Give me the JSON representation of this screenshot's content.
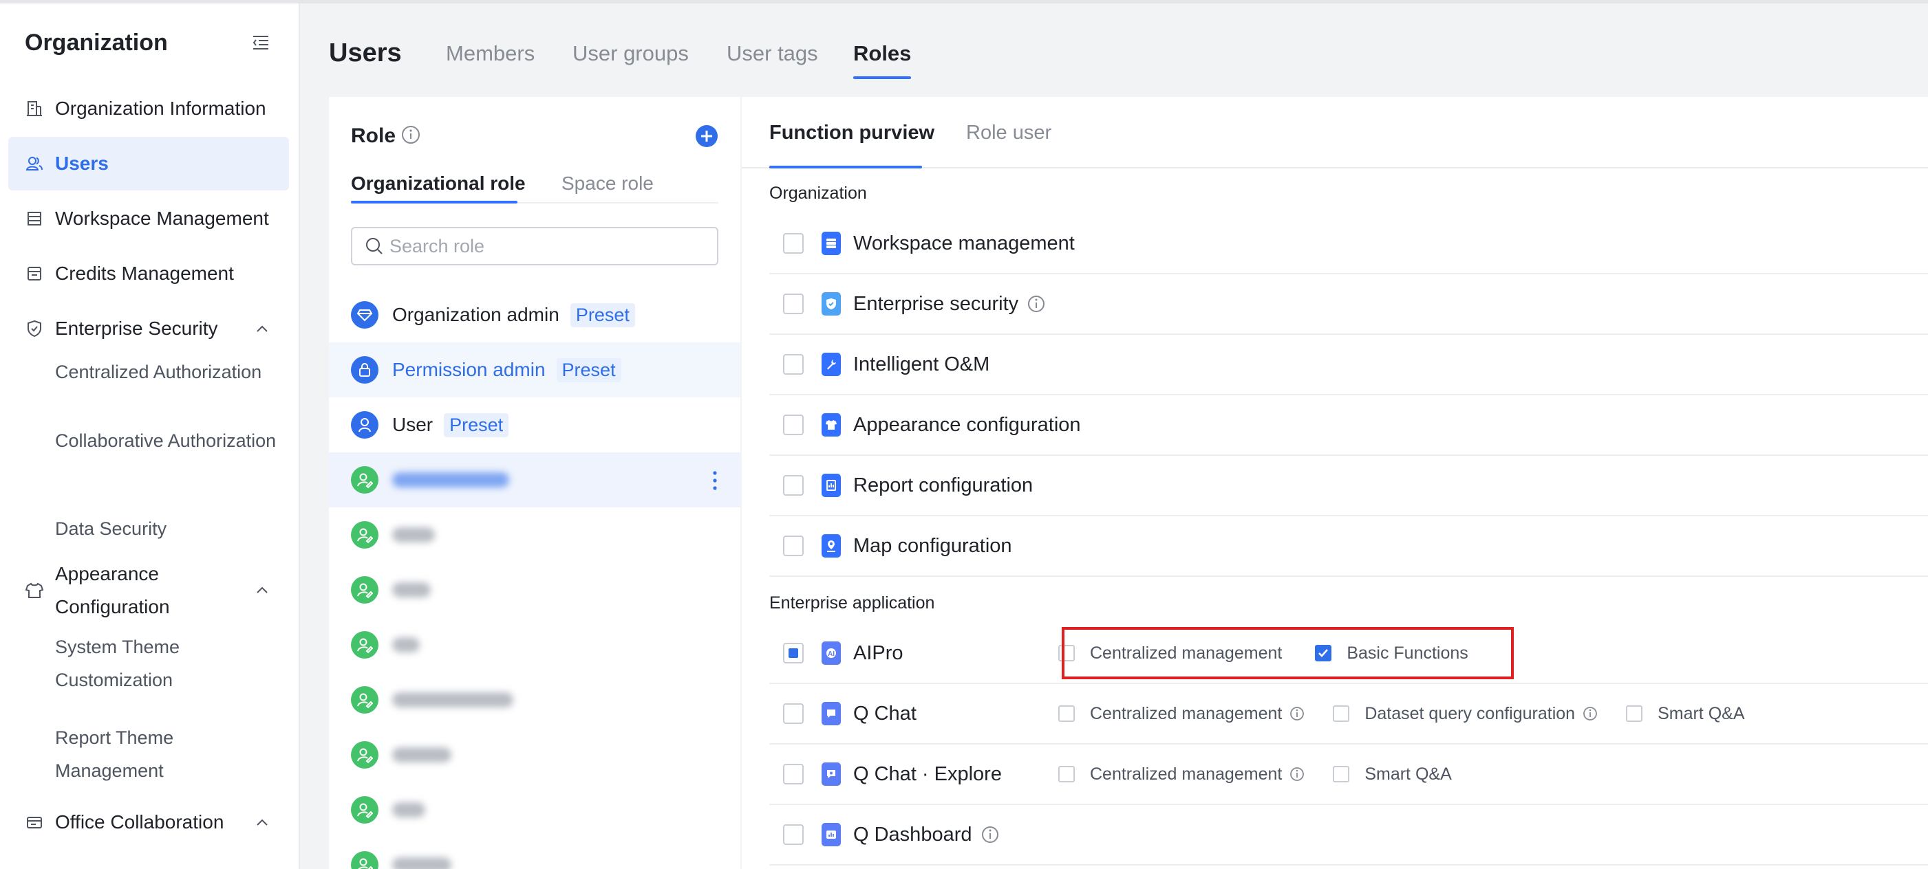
{
  "sidebar": {
    "title": "Organization",
    "items": [
      {
        "label": "Organization Information"
      },
      {
        "label": "Users"
      },
      {
        "label": "Workspace Management"
      },
      {
        "label": "Credits Management"
      },
      {
        "label": "Enterprise Security"
      },
      {
        "label": "Appearance Configuration"
      },
      {
        "label": "Office Collaboration"
      }
    ],
    "security_subitems": [
      "Centralized Authorization",
      "Collaborative Authorization",
      "Data Security"
    ],
    "appearance_subitems": [
      "System Theme Customization",
      "Report Theme Management"
    ]
  },
  "header": {
    "title": "Users",
    "tabs": [
      {
        "label": "Members"
      },
      {
        "label": "User groups"
      },
      {
        "label": "User tags"
      },
      {
        "label": "Roles"
      }
    ]
  },
  "roles": {
    "title": "Role",
    "tabs": [
      {
        "label": "Organizational role"
      },
      {
        "label": "Space role"
      }
    ],
    "search_placeholder": "Search role",
    "preset_label": "Preset",
    "list": [
      {
        "name": "Organization admin",
        "preset": true
      },
      {
        "name": "Permission admin",
        "preset": true
      },
      {
        "name": "User",
        "preset": true
      }
    ]
  },
  "function": {
    "tabs": [
      {
        "label": "Function purview"
      },
      {
        "label": "Role user"
      }
    ],
    "sections": [
      {
        "title": "Organization",
        "items": [
          {
            "label": "Workspace management",
            "icon": "workspace-icon",
            "color": "#3370ff"
          },
          {
            "label": "Enterprise security",
            "icon": "shield-icon",
            "color": "#4fa3f7"
          },
          {
            "label": "Intelligent O&M",
            "icon": "wrench-icon",
            "color": "#3370ff"
          },
          {
            "label": "Appearance configuration",
            "icon": "shirt-icon",
            "color": "#3370ff"
          },
          {
            "label": "Report configuration",
            "icon": "report-icon",
            "color": "#3370ff"
          },
          {
            "label": "Map configuration",
            "icon": "map-pin-icon",
            "color": "#3370ff"
          }
        ]
      },
      {
        "title": "Enterprise application",
        "items": [
          {
            "label": "AIPro",
            "state": "partial",
            "options": [
              {
                "label": "Centralized management",
                "checked": false
              },
              {
                "label": "Basic Functions",
                "checked": true
              }
            ]
          },
          {
            "label": "Q Chat",
            "options": [
              {
                "label": "Centralized management",
                "checked": false
              },
              {
                "label": "Dataset query configuration",
                "checked": false
              },
              {
                "label": "Smart Q&A",
                "checked": false
              }
            ]
          },
          {
            "label": "Q Chat · Explore",
            "options": [
              {
                "label": "Centralized management",
                "checked": false
              },
              {
                "label": "Smart Q&A",
                "checked": false
              }
            ]
          },
          {
            "label": "Q Dashboard"
          }
        ]
      }
    ]
  },
  "colors": {
    "accent": "#3370ff",
    "avatar_green": "#43c26a",
    "highlight": "#e02020"
  }
}
